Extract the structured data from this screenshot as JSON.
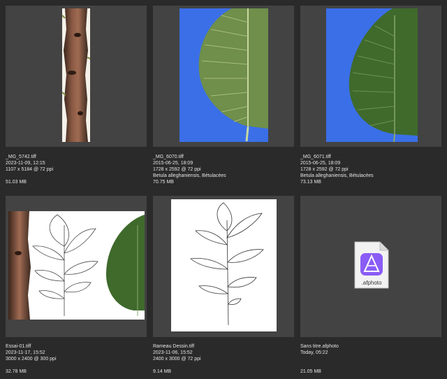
{
  "files": [
    {
      "name": "_MG_5742.tiff",
      "date": "2023-11-09, 12:15",
      "dimensions": "1107 x 5184 @ 72 ppi",
      "keywords": "",
      "size": "51.03 MB",
      "thumb": "bark-strip-icon"
    },
    {
      "name": "_MG_6070.tiff",
      "date": "2015-06-25, 18:09",
      "dimensions": "1728 x 2592 @ 72 ppi",
      "keywords": "Betula alleghaniensis, Bétulacées",
      "size": "70.75 MB",
      "thumb": "leaf-photo-icon"
    },
    {
      "name": "_MG_6071.tiff",
      "date": "2015-06-25, 18:09",
      "dimensions": "1728 x 2592 @ 72 ppi",
      "keywords": "Betula alleghaniensis, Bétulacées",
      "size": "73.13 MB",
      "thumb": "leaf-photo-icon"
    },
    {
      "name": "Essai-01.tiff",
      "date": "2023-11-17, 15:52",
      "dimensions": "3000 x 2400 @ 300 ppi",
      "keywords": "",
      "size": "32.78 MB",
      "thumb": "composite-icon"
    },
    {
      "name": "Rameau Dessin.tiff",
      "date": "2023-11-06, 15:52",
      "dimensions": "2400 x 3000 @ 72 ppi",
      "keywords": "",
      "size": "9.14 MB",
      "thumb": "drawing-icon"
    },
    {
      "name": "Sans titre.afphoto",
      "date": "Today, 05:22",
      "dimensions": "",
      "keywords": "",
      "size": "21.05 MB",
      "thumb": "afphoto-file-icon",
      "doc_label": ".afphoto"
    }
  ],
  "colors": {
    "background": "#2a2a2a",
    "tile": "#434343",
    "blue_backdrop": "#3b6fe8",
    "affinity_purple": "#8a5cf6"
  }
}
